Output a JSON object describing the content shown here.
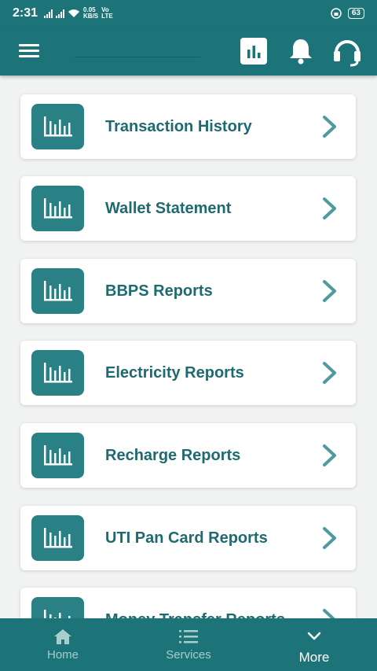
{
  "status_bar": {
    "time": "2:31",
    "net_speed_top": "0.05",
    "net_speed_bottom": "KB/S",
    "network_top": "Vo",
    "network_bottom": "LTE",
    "battery": "63"
  },
  "app_bar": {
    "icons": [
      "menu-icon",
      "reports-icon",
      "bell-icon",
      "headset-icon"
    ]
  },
  "reports": [
    {
      "label": "Transaction History",
      "icon": "bar-chart-icon"
    },
    {
      "label": "Wallet Statement",
      "icon": "bar-chart-icon"
    },
    {
      "label": "BBPS Reports",
      "icon": "bar-chart-icon"
    },
    {
      "label": "Electricity Reports",
      "icon": "bar-chart-icon"
    },
    {
      "label": "Recharge Reports",
      "icon": "bar-chart-icon"
    },
    {
      "label": "UTI Pan Card Reports",
      "icon": "bar-chart-icon"
    },
    {
      "label": "Money Transfer Reports",
      "icon": "bar-chart-icon"
    }
  ],
  "bottom_nav": {
    "items": [
      {
        "label": "Home",
        "icon": "home-icon"
      },
      {
        "label": "Services",
        "icon": "list-icon"
      },
      {
        "label": "More",
        "icon": "chevron-down-icon",
        "active": true
      }
    ]
  },
  "colors": {
    "primary": "#1c7479",
    "icon_tile": "#2a8185",
    "label_text": "#1e6a70",
    "chevron": "#4e9a9e",
    "background": "#f1f2f2"
  }
}
